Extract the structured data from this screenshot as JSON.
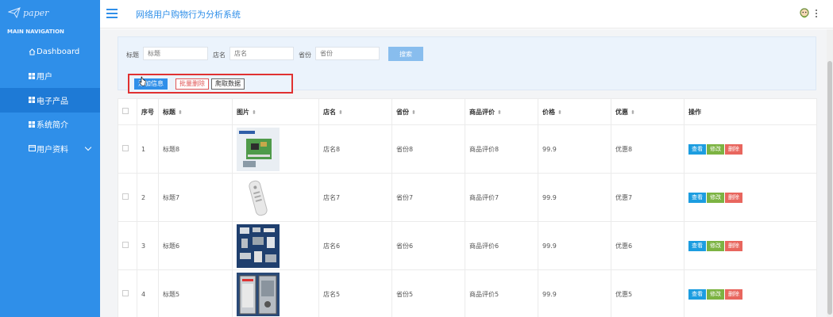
{
  "sidebar": {
    "logo_text": "paper",
    "nav_header": "MAIN NAVIGATION",
    "items": [
      {
        "label": "Dashboard",
        "icon": "home-icon"
      },
      {
        "label": "用户",
        "icon": "grid-icon"
      },
      {
        "label": "电子产品",
        "icon": "grid-icon"
      },
      {
        "label": "系统简介",
        "icon": "grid-icon"
      },
      {
        "label": "用户资料",
        "icon": "calendar-icon"
      }
    ],
    "active_index": 2
  },
  "header": {
    "title": "网络用户购物行为分析系统"
  },
  "filter": {
    "title_label": "标题",
    "title_placeholder": "标题",
    "shop_label": "店名",
    "shop_placeholder": "店名",
    "province_label": "省份",
    "province_placeholder": "省份",
    "search_label": "搜索"
  },
  "actions": {
    "add_label": "添加信息",
    "batch_delete_label": "批量删除",
    "crawl_label": "爬取数据"
  },
  "table": {
    "columns": [
      "序号",
      "标题",
      "图片",
      "店名",
      "省份",
      "商品评价",
      "价格",
      "优惠",
      "操作"
    ],
    "rows": [
      {
        "index": "1",
        "title": "标题8",
        "shop": "店名8",
        "province": "省份8",
        "review": "商品评价8",
        "price": "99.9",
        "discount": "优惠8"
      },
      {
        "index": "2",
        "title": "标题7",
        "shop": "店名7",
        "province": "省份7",
        "review": "商品评价7",
        "price": "99.9",
        "discount": "优惠7"
      },
      {
        "index": "3",
        "title": "标题6",
        "shop": "店名6",
        "province": "省份6",
        "review": "商品评价6",
        "price": "99.9",
        "discount": "优惠6"
      },
      {
        "index": "4",
        "title": "标题5",
        "shop": "店名5",
        "province": "省份5",
        "review": "商品评价5",
        "price": "99.9",
        "discount": "优惠5"
      }
    ],
    "op_view": "查看",
    "op_edit": "修改",
    "op_delete": "删除"
  },
  "colors": {
    "sidebar": "#2f8fe9",
    "accent": "#2f8fe9",
    "view": "#1c9de0",
    "edit": "#7cb342",
    "delete": "#e8665e",
    "highlight": "#e03131"
  }
}
